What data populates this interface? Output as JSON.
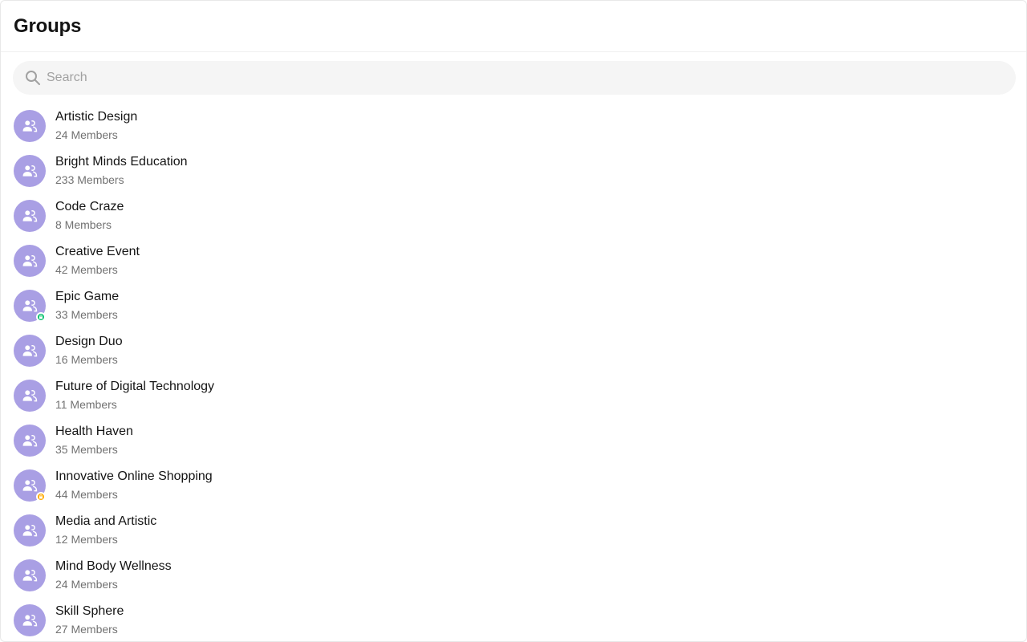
{
  "header": {
    "title": "Groups"
  },
  "search": {
    "placeholder": "Search",
    "value": ""
  },
  "colors": {
    "avatar_bg": "#a99fe4",
    "password_badge": "#09c26f",
    "private_badge": "#ffab00"
  },
  "groups": [
    {
      "name": "Artistic Design",
      "members": "24 Members",
      "type": "public",
      "icon": "group-icon"
    },
    {
      "name": "Bright Minds Education",
      "members": "233 Members",
      "type": "public",
      "icon": "group-icon"
    },
    {
      "name": "Code Craze",
      "members": "8 Members",
      "type": "public",
      "icon": "group-icon"
    },
    {
      "name": "Creative Event",
      "members": "42 Members",
      "type": "public",
      "icon": "group-icon"
    },
    {
      "name": "Epic Game",
      "members": "33 Members",
      "type": "password",
      "icon": "group-icon"
    },
    {
      "name": "Design Duo",
      "members": "16 Members",
      "type": "public",
      "icon": "group-icon"
    },
    {
      "name": "Future of Digital Technology",
      "members": "11 Members",
      "type": "public",
      "icon": "group-icon"
    },
    {
      "name": "Health Haven",
      "members": "35 Members",
      "type": "public",
      "icon": "group-icon"
    },
    {
      "name": "Innovative Online Shopping",
      "members": "44 Members",
      "type": "private",
      "icon": "group-icon"
    },
    {
      "name": "Media and Artistic",
      "members": "12 Members",
      "type": "public",
      "icon": "group-icon"
    },
    {
      "name": "Mind Body Wellness",
      "members": "24 Members",
      "type": "public",
      "icon": "group-icon"
    },
    {
      "name": "Skill Sphere",
      "members": "27 Members",
      "type": "public",
      "icon": "group-icon"
    }
  ]
}
